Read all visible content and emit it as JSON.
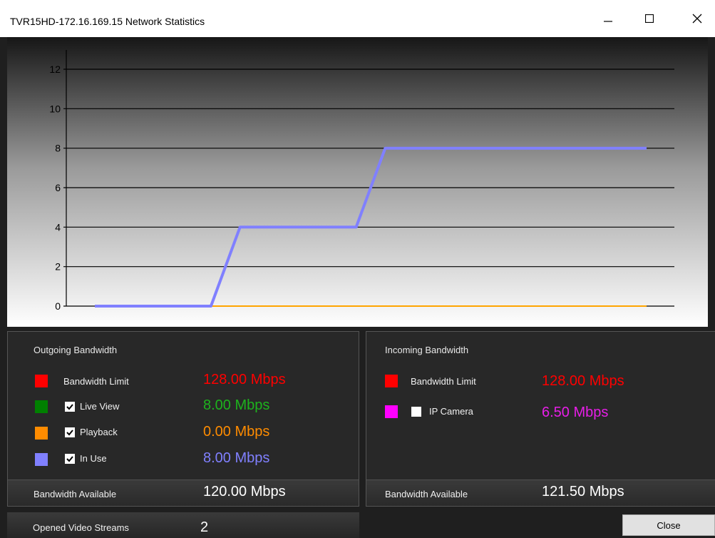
{
  "window": {
    "title": "TVR15HD-172.16.169.15 Network Statistics",
    "minimize_icon": "minimize-icon",
    "maximize_icon": "maximize-icon",
    "close_icon": "close-icon"
  },
  "chart_data": {
    "type": "line",
    "x": [
      0,
      1,
      2,
      3,
      4,
      5,
      6,
      7,
      8,
      9,
      10,
      11,
      12,
      13,
      14,
      15,
      16,
      17,
      18,
      19
    ],
    "ylim": [
      0,
      12
    ],
    "yticks": [
      "0",
      "2",
      "4",
      "6",
      "8",
      "10",
      "12"
    ],
    "grid": true,
    "series": [
      {
        "color": "#ffa500",
        "values": [
          0,
          0,
          0,
          0,
          0,
          0,
          0,
          0,
          0,
          0,
          0,
          0,
          0,
          0,
          0,
          0,
          0,
          0,
          0,
          0
        ]
      },
      {
        "color": "#8080ff",
        "values": [
          0,
          0,
          0,
          0,
          0,
          4,
          4,
          4,
          4,
          4,
          8,
          8,
          8,
          8,
          8,
          8,
          8,
          8,
          8,
          8
        ]
      }
    ]
  },
  "outgoing": {
    "title": "Outgoing Bandwidth",
    "rows": [
      {
        "label": "Bandwidth Limit",
        "value": "128.00 Mbps",
        "color": "#ff0000",
        "checkbox": false
      },
      {
        "label": "Live View",
        "value": "8.00 Mbps",
        "color": "#008000",
        "value_color": "#1db31d",
        "checkbox": true
      },
      {
        "label": "Playback",
        "value": "0.00 Mbps",
        "color": "#ff8c00",
        "value_color": "#ff8c00",
        "checkbox": true
      },
      {
        "label": "In Use",
        "value": "8.00 Mbps",
        "color": "#8080ff",
        "value_color": "#8080ff",
        "checkbox": true
      }
    ],
    "available_label": "Bandwidth Available",
    "available_value": "120.00 Mbps"
  },
  "incoming": {
    "title": "Incoming Bandwidth",
    "rows": [
      {
        "label": "Bandwidth Limit",
        "value": "128.00 Mbps",
        "color": "#ff0000",
        "checkbox": false
      },
      {
        "label": "IP Camera",
        "value": "6.50 Mbps",
        "color": "#ff00ff",
        "value_color": "#e81ee8",
        "checkbox": true,
        "checked": false
      }
    ],
    "available_label": "Bandwidth Available",
    "available_value": "121.50 Mbps"
  },
  "streams": {
    "label": "Opened Video Streams",
    "value": "2"
  },
  "buttons": {
    "close": "Close"
  }
}
